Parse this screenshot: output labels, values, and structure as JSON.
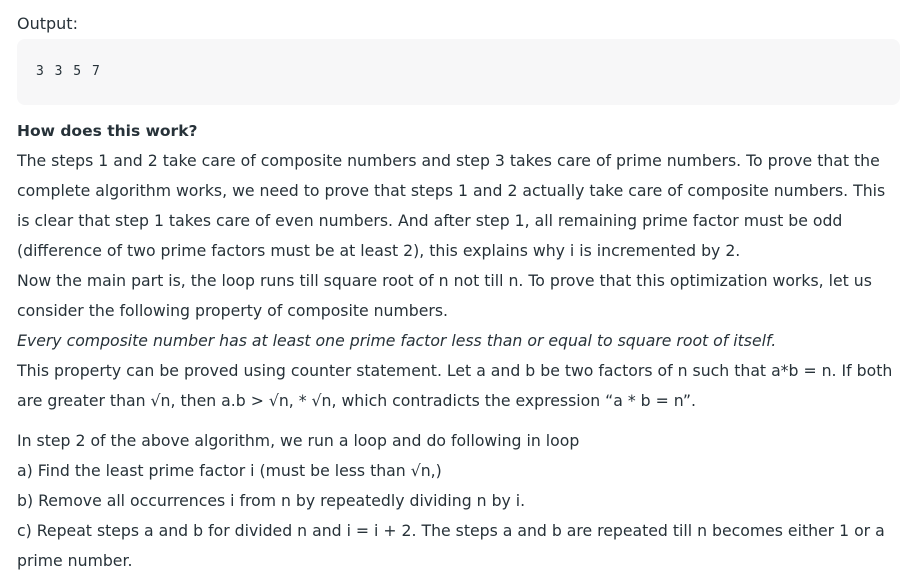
{
  "output": {
    "label": "Output:",
    "code": "3 3 5 7"
  },
  "explanation": {
    "heading": "How does this work?",
    "block1": [
      "The steps 1 and 2 take care of composite numbers and step 3 takes care of prime numbers. To prove that the",
      "complete algorithm works, we need to prove that steps 1 and 2 actually take care of composite numbers. This",
      "is clear that step 1 takes care of even numbers. And after step 1, all remaining prime factor must be odd",
      "(difference of two prime factors must be at least 2), this explains why i is incremented by 2.",
      "Now the main part is, the loop runs till square root of n not till n. To prove that this optimization works, let us",
      "consider the following property of composite numbers."
    ],
    "property_statement": "Every composite number has at least one prime factor less than or equal to square root of itself.",
    "block2": [
      "This property can be proved using counter statement. Let a and b be two factors of n such that a*b = n. If both",
      "are greater than √n, then a.b > √n, * √n, which contradicts the expression “a * b = n”."
    ],
    "block3": [
      "In step 2 of the above algorithm, we run a loop and do following in loop",
      "a) Find the least prime factor i (must be less than √n,)",
      "b) Remove all occurrences i from n by repeatedly dividing n by i.",
      "c) Repeat steps a and b for divided n and i = i + 2. The steps a and b are repeated till n becomes either 1 or a",
      "prime number."
    ]
  }
}
